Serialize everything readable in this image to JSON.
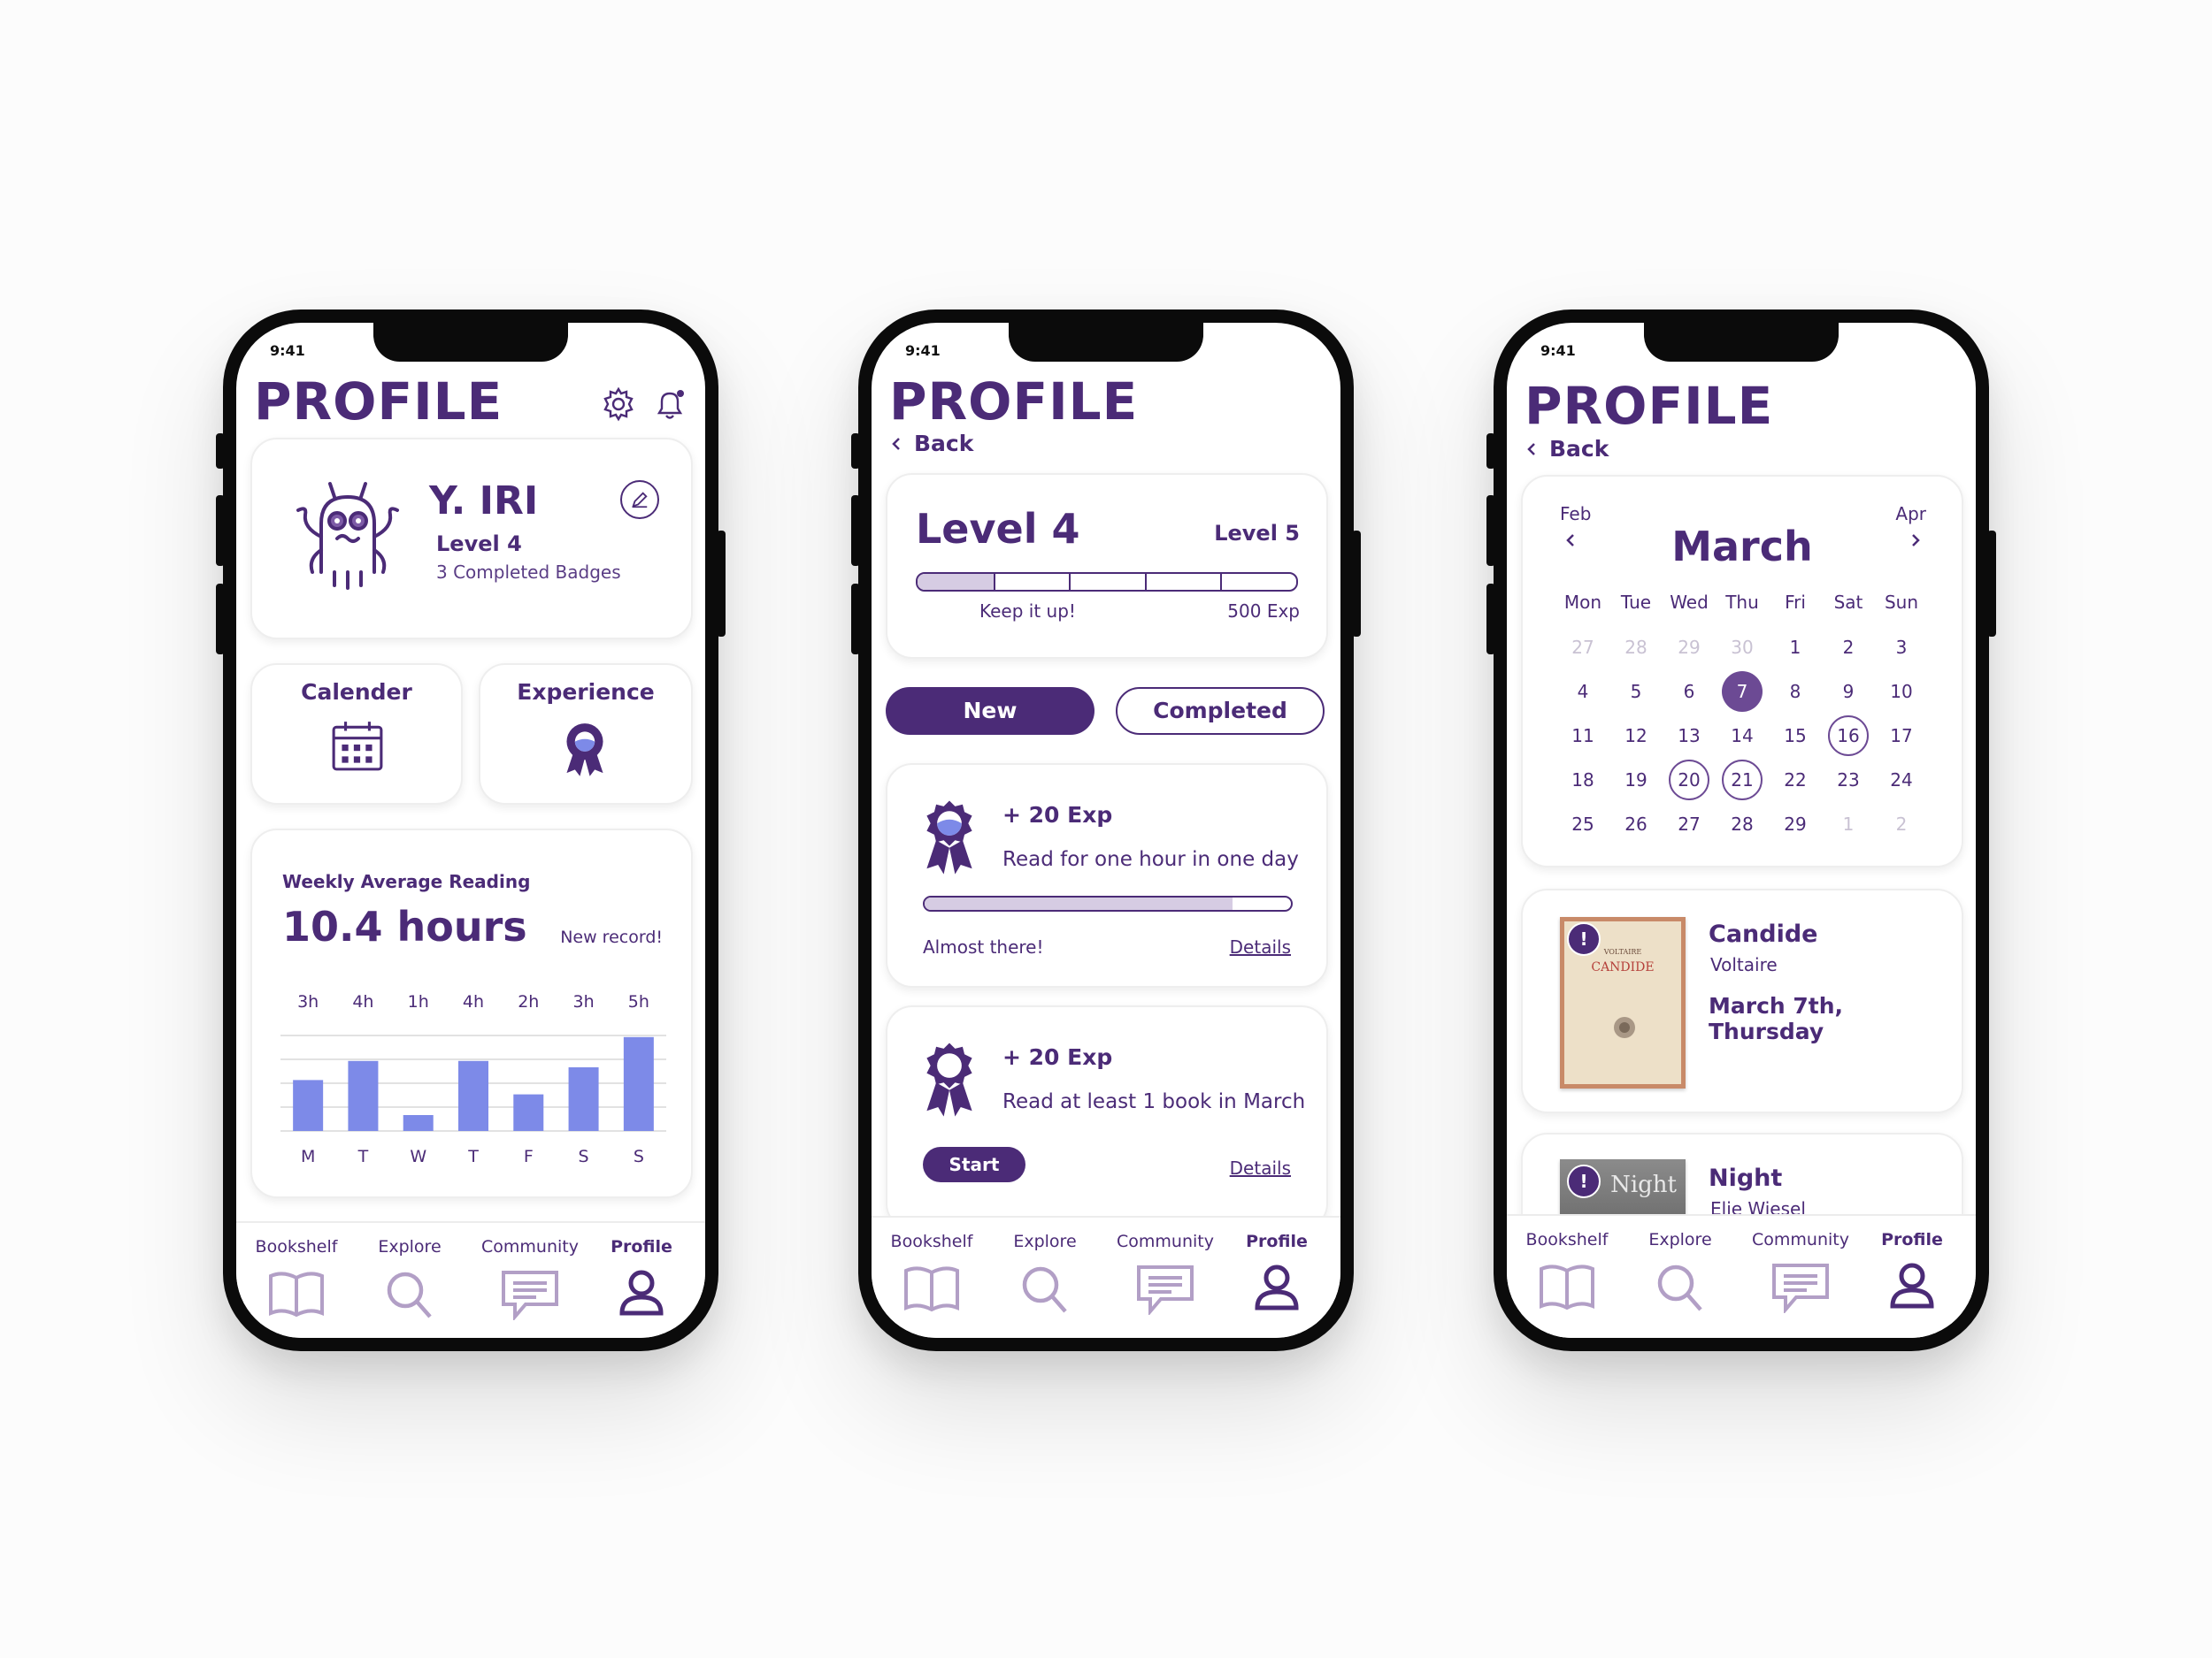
{
  "colors": {
    "primary": "#4b2b77",
    "bar": "#7d8ae8",
    "progress_fill": "#d6cce3",
    "muted": "#c9c2d3"
  },
  "status_time": "9:41",
  "app_title": "PROFILE",
  "back_label": "Back",
  "tabs": [
    "Bookshelf",
    "Explore",
    "Community",
    "Profile"
  ],
  "screen1": {
    "user": {
      "name": "Y. IRI",
      "level": "Level 4",
      "badges": "3 Completed Badges"
    },
    "tiles": {
      "calendar": "Calender",
      "experience": "Experience"
    },
    "reading": {
      "title": "Weekly Average Reading",
      "value": "10.4 hours",
      "note": "New record!"
    }
  },
  "chart_data": {
    "type": "bar",
    "title": "Weekly Average Reading",
    "categories": [
      "M",
      "T",
      "W",
      "T",
      "F",
      "S",
      "S"
    ],
    "value_labels": [
      "3h",
      "4h",
      "1h",
      "4h",
      "2h",
      "3h",
      "5h"
    ],
    "values": [
      3.2,
      4.4,
      1.0,
      4.4,
      2.3,
      4.0,
      5.9
    ],
    "ylim": [
      0,
      6
    ],
    "grid": true,
    "color": "#7d8ae8"
  },
  "screen2": {
    "level_current": "Level 4",
    "level_next": "Level 5",
    "level_progress": 0.2,
    "progress_note": "Keep it up!",
    "exp_total": "500 Exp",
    "toggle_new": "New",
    "toggle_completed": "Completed",
    "quests": [
      {
        "reward": "+ 20 Exp",
        "desc": "Read for one hour in one day",
        "status": "Almost there!",
        "progress": 0.84,
        "details": "Details"
      },
      {
        "reward": "+ 20 Exp",
        "desc": "Read at least 1 book in March",
        "action": "Start",
        "details": "Details"
      }
    ]
  },
  "screen3": {
    "prev_month": "Feb",
    "next_month": "Apr",
    "month": "March",
    "weekdays": [
      "Mon",
      "Tue",
      "Wed",
      "Thu",
      "Fri",
      "Sat",
      "Sun"
    ],
    "weeks": [
      [
        "27",
        "28",
        "29",
        "30",
        "1",
        "2",
        "3"
      ],
      [
        "4",
        "5",
        "6",
        "7",
        "8",
        "9",
        "10"
      ],
      [
        "11",
        "12",
        "13",
        "14",
        "15",
        "16",
        "17"
      ],
      [
        "18",
        "19",
        "20",
        "21",
        "22",
        "23",
        "24"
      ],
      [
        "25",
        "26",
        "27",
        "28",
        "29",
        "1",
        "2"
      ]
    ],
    "selected_day": "7",
    "marked_days": [
      "16",
      "20",
      "21"
    ],
    "books": [
      {
        "title": "Candide",
        "author": "Voltaire",
        "date": "March 7th, Thursday",
        "cover_title": "CANDIDE",
        "cover_author": "VOLTAIRE"
      },
      {
        "title": "Night",
        "author": "Elie Wiesel",
        "cover_title": "Night"
      }
    ]
  }
}
